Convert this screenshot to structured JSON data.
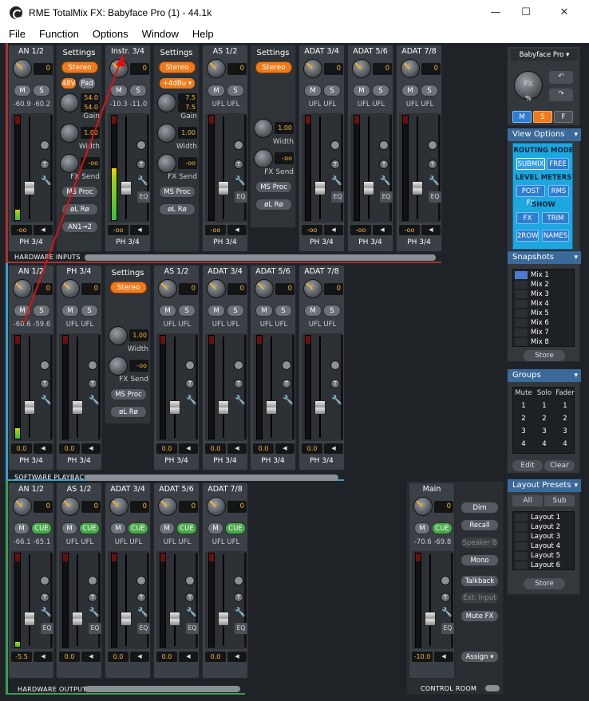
{
  "window": {
    "title": "RME TotalMix FX: Babyface Pro (1) - 44.1k",
    "min": "—",
    "max": "☐",
    "close": "✕"
  },
  "menu": [
    "File",
    "Function",
    "Options",
    "Window",
    "Help"
  ],
  "inputs": {
    "label": "HARDWARE INPUTS",
    "strips": [
      {
        "name": "AN 1/2",
        "gain": "0",
        "lvl": "-60.9 -60.2",
        "fval": "-oo",
        "bottom": "PH 3/4",
        "meter": 0.1
      },
      {
        "name": "Instr. 3/4",
        "gain": "0",
        "lvl": "-10.3 -11.0",
        "fval": "-oo",
        "bottom": "PH 3/4",
        "meter": 0.5
      },
      {
        "name": "AS 1/2",
        "gain": "0",
        "lvl": "UFL UFL",
        "fval": "-oo",
        "bottom": "PH 3/4",
        "meter": 0
      },
      {
        "name": "ADAT 3/4",
        "gain": "0",
        "lvl": "UFL UFL",
        "fval": "-oo",
        "bottom": "PH 3/4",
        "meter": 0
      },
      {
        "name": "ADAT 5/6",
        "gain": "0",
        "lvl": "UFL UFL",
        "fval": "-oo",
        "bottom": "PH 3/4",
        "meter": 0
      },
      {
        "name": "ADAT 7/8",
        "gain": "0",
        "lvl": "UFL UFL",
        "fval": "-oo",
        "bottom": "PH 3/4",
        "meter": 0
      }
    ],
    "settings1": {
      "title": "Settings",
      "stereo": "Stereo",
      "v48": "48V",
      "pad": "Pad",
      "gain1": "54.0",
      "gain2": "54.0",
      "gain": "Gain",
      "width_val": "1.00",
      "width": "Width",
      "fx_val": "-oo",
      "fxsend": "FX Send",
      "msproc": "MS Proc",
      "phase": "øL Rø",
      "route": "AN1→2"
    },
    "settings2": {
      "title": "Settings",
      "stereo": "Stereo",
      "ref": "+4dBu ▾",
      "gain1": "7.5",
      "gain2": "7.5",
      "gain": "Gain",
      "width_val": "1.00",
      "width": "Width",
      "fx_val": "-oo",
      "fxsend": "FX Send",
      "msproc": "MS Proc",
      "phase": "øL Rø"
    },
    "settings3": {
      "title": "Settings",
      "stereo": "Stereo",
      "width_val": "1.00",
      "width": "Width",
      "fx_val": "-oo",
      "fxsend": "FX Send",
      "msproc": "MS Proc",
      "phase": "øL Rø"
    }
  },
  "playback": {
    "label": "SOFTWARE PLAYBACK",
    "strips": [
      {
        "name": "AN 1/2",
        "lvl": "-60.6 -59.6",
        "fval": "0.0",
        "bottom": "PH 3/4",
        "meter": 0.1
      },
      {
        "name": "PH 3/4",
        "lvl": "UFL UFL",
        "fval": "0.0",
        "bottom": "PH 3/4",
        "meter": 0
      },
      {
        "name": "AS 1/2",
        "lvl": "UFL UFL",
        "fval": "0.0",
        "bottom": "PH 3/4",
        "meter": 0
      },
      {
        "name": "ADAT 3/4",
        "lvl": "UFL UFL",
        "fval": "0.0",
        "bottom": "PH 3/4",
        "meter": 0
      },
      {
        "name": "ADAT 5/6",
        "lvl": "UFL UFL",
        "fval": "0.0",
        "bottom": "PH 3/4",
        "meter": 0
      },
      {
        "name": "ADAT 7/8",
        "lvl": "UFL UFL",
        "fval": "0.0",
        "bottom": "PH 3/4",
        "meter": 0
      }
    ],
    "settings": {
      "title": "Settings",
      "stereo": "Stereo",
      "width_val": "1.00",
      "width": "Width",
      "fx_val": "-oo",
      "fxsend": "FX Send",
      "msproc": "MS Proc",
      "phase": "øL Rø"
    }
  },
  "outputs": {
    "label": "HARDWARE OUTPUTS",
    "strips": [
      {
        "name": "AN 1/2",
        "lvl": "-66.1 -65.1",
        "fval": "-5.5",
        "meter": 0.05
      },
      {
        "name": "AS 1/2",
        "lvl": "UFL UFL",
        "fval": "0.0",
        "meter": 0
      },
      {
        "name": "ADAT 3/4",
        "lvl": "UFL UFL",
        "fval": "0.0",
        "meter": 0
      },
      {
        "name": "ADAT 5/6",
        "lvl": "UFL UFL",
        "fval": "0.0",
        "meter": 0
      },
      {
        "name": "ADAT 7/8",
        "lvl": "UFL UFL",
        "fval": "0.0",
        "meter": 0
      }
    ],
    "m": "M",
    "cue": "CUE",
    "eq": "EQ"
  },
  "control_room": {
    "label": "CONTROL ROOM",
    "name": "Main",
    "gain": "0",
    "lvl": "-70.6 -69.8",
    "fval": "-10.0",
    "buttons": [
      "Dim",
      "Recall",
      "Speaker B",
      "Mono",
      "Talkback",
      "Ext. Input",
      "Mute FX",
      "Assign ▾"
    ]
  },
  "sidebar": {
    "device": "Babyface Pro ▾",
    "fx": "FX",
    "pct": "%",
    "m": "M",
    "s": "S",
    "f": "F",
    "view_options": "View Options",
    "routing_mode": "ROUTING MODE",
    "submix": "SUBMIX",
    "free": "FREE",
    "level_meters": "LEVEL METERS",
    "postfx": "POST FX",
    "rms": "RMS",
    "show": "SHOW",
    "fxb": "FX",
    "trim": "TRIM",
    "row2": "2ROW",
    "names": "NAMES",
    "snapshots": "Snapshots",
    "mixes": [
      "Mix 1",
      "Mix 2",
      "Mix 3",
      "Mix 4",
      "Mix 5",
      "Mix 6",
      "Mix 7",
      "Mix 8"
    ],
    "store": "Store",
    "groups": "Groups",
    "group_headers": [
      "Mute",
      "Solo",
      "Fader"
    ],
    "group_rows": [
      [
        "1",
        "1",
        "1"
      ],
      [
        "2",
        "2",
        "2"
      ],
      [
        "3",
        "3",
        "3"
      ],
      [
        "4",
        "4",
        "4"
      ]
    ],
    "edit": "Edit",
    "clear": "Clear",
    "layout_presets": "Layout Presets",
    "all": "All",
    "sub": "Sub",
    "layouts": [
      "Layout 1",
      "Layout 2",
      "Layout 3",
      "Layout 4",
      "Layout 5",
      "Layout 6"
    ],
    "store2": "Store"
  },
  "colors": {
    "accent": "#f07a1a",
    "value": "#ffb52e",
    "panel_header": "#3b6a9a",
    "cyan": "#1ea7df",
    "annotation": "#e01010"
  },
  "common": {
    "m": "M",
    "s": "S",
    "t": "T",
    "eq": "EQ"
  }
}
